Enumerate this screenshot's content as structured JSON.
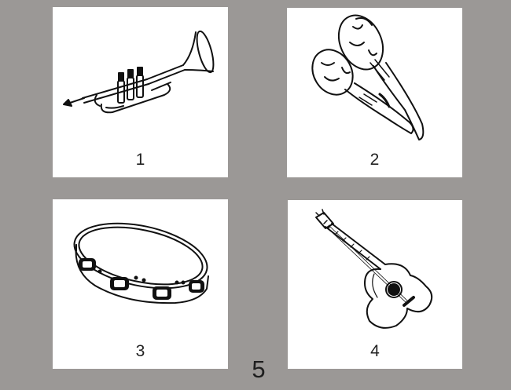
{
  "cards": [
    {
      "number": "1",
      "icon": "trumpet-icon"
    },
    {
      "number": "2",
      "icon": "maracas-icon"
    },
    {
      "number": "3",
      "icon": "tambourine-icon"
    },
    {
      "number": "4",
      "icon": "guitar-icon"
    }
  ],
  "page_number": "5",
  "colors": {
    "background": "#9b9896",
    "card": "#ffffff",
    "ink": "#111111"
  }
}
